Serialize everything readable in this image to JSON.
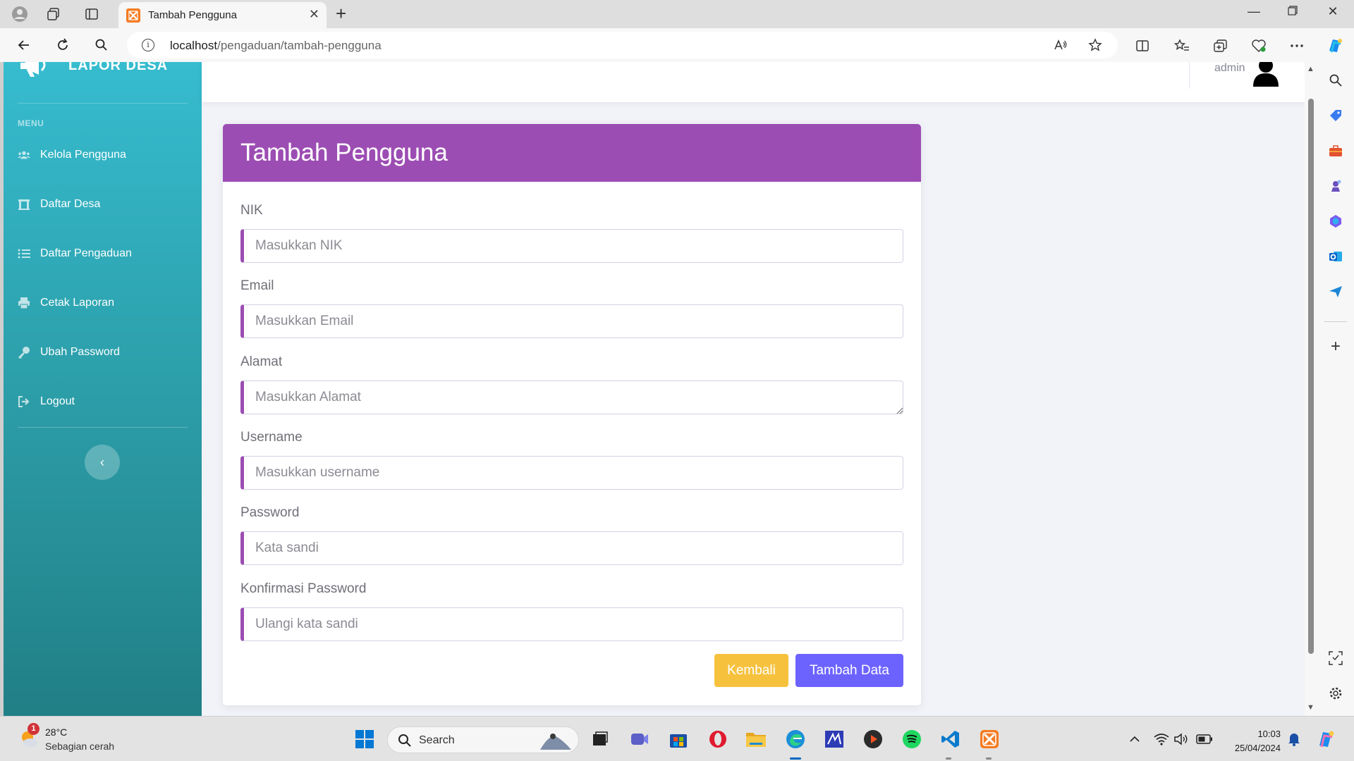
{
  "browser": {
    "tab_title": "Tambah Pengguna",
    "url_host": "localhost",
    "url_path": "/pengaduan/tambah-pengguna"
  },
  "sidebar": {
    "brand": "LAPOR DESA",
    "heading": "MENU",
    "items": [
      {
        "label": "Kelola Pengguna",
        "icon": "users-icon"
      },
      {
        "label": "Daftar Desa",
        "icon": "landmark-icon"
      },
      {
        "label": "Daftar Pengaduan",
        "icon": "list-icon"
      },
      {
        "label": "Cetak Laporan",
        "icon": "print-icon"
      },
      {
        "label": "Ubah Password",
        "icon": "key-icon"
      },
      {
        "label": "Logout",
        "icon": "logout-icon"
      }
    ],
    "toggle": "‹"
  },
  "topbar": {
    "username": "admin"
  },
  "form": {
    "title": "Tambah Pengguna",
    "fields": [
      {
        "label": "NIK",
        "placeholder": "Masukkan NIK"
      },
      {
        "label": "Email",
        "placeholder": "Masukkan Email"
      },
      {
        "label": "Alamat",
        "placeholder": "Masukkan Alamat"
      },
      {
        "label": "Username",
        "placeholder": "Masukkan username"
      },
      {
        "label": "Password",
        "placeholder": "Kata sandi"
      },
      {
        "label": "Konfirmasi Password",
        "placeholder": "Ulangi kata sandi"
      }
    ],
    "back_label": "Kembali",
    "submit_label": "Tambah Data"
  },
  "taskbar": {
    "weather_temp": "28°C",
    "weather_desc": "Sebagian cerah",
    "weather_badge": "1",
    "search_label": "Search",
    "time": "10:03",
    "date": "25/04/2024"
  },
  "colors": {
    "sidebar_top": "#36bccf",
    "sidebar_bottom": "#217f86",
    "header_purple": "#9c4db3",
    "button_warning": "#f6c23e",
    "button_primary": "#6c63ff"
  }
}
